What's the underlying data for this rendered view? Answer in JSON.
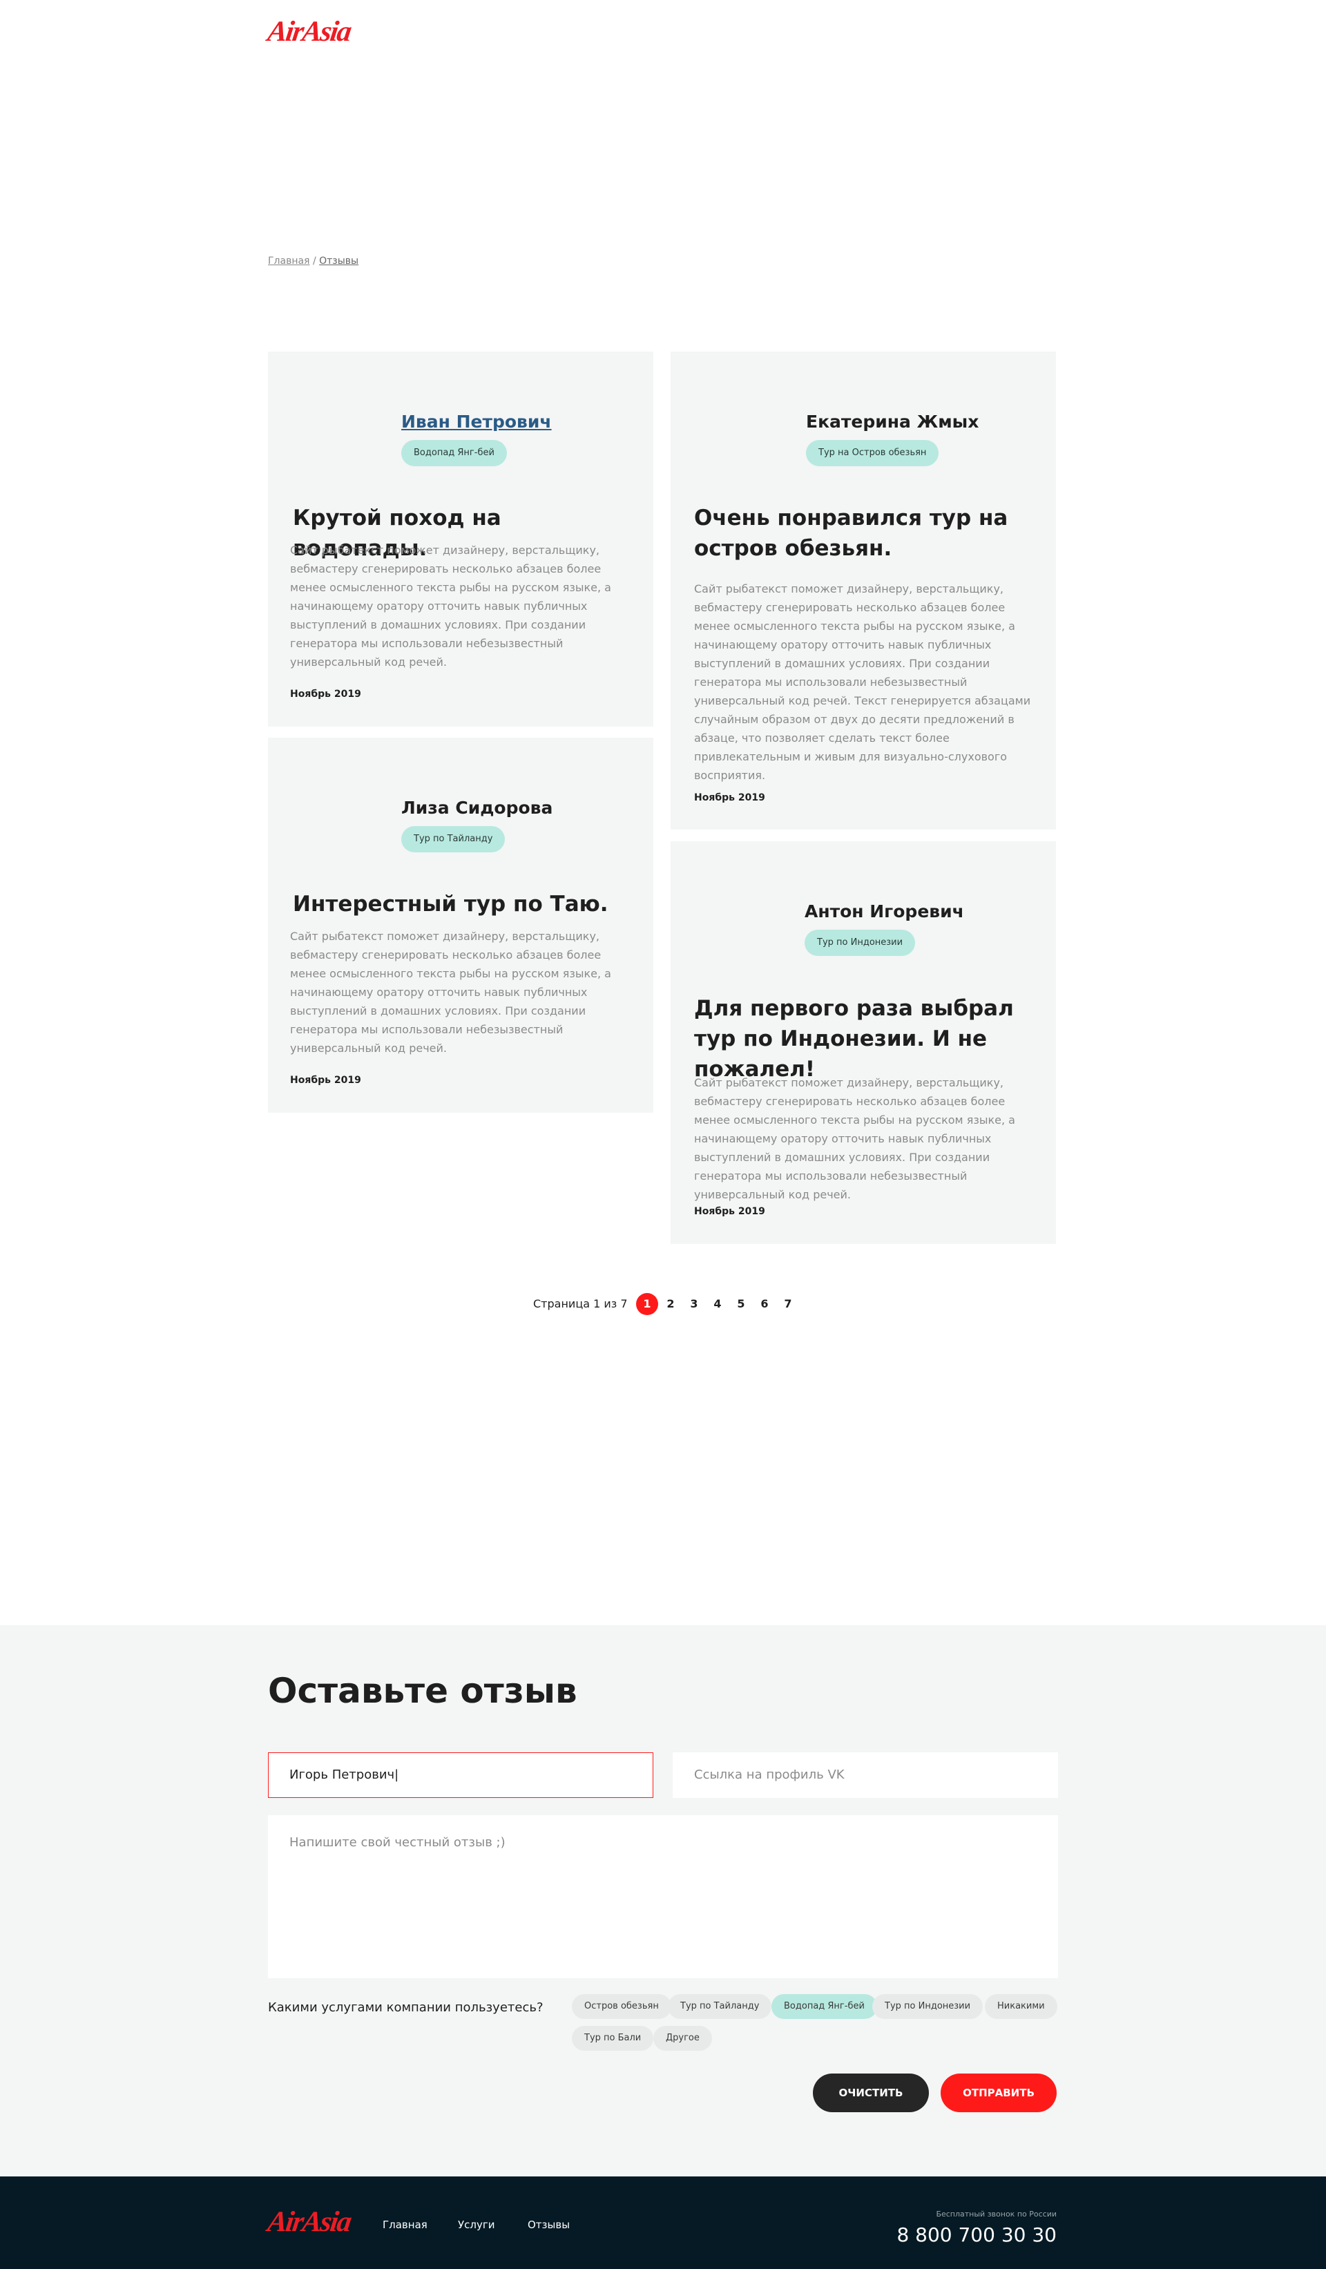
{
  "brand": {
    "logo_text": "AirAsia",
    "accent": "#ed1c24"
  },
  "breadcrumb": {
    "home": "Главная",
    "separator": "/",
    "current": "Отзывы"
  },
  "reviews": [
    {
      "author": "Иван Петрович",
      "tour": "Водопад Янг-бей",
      "title": "Крутой поход на водопады.",
      "text": "Сайт рыбатекст поможет дизайнеру, верстальщику, вебмастеру сгенерировать несколько абзацев более менее осмысленного текста рыбы на русском языке, а начинающему оратору отточить навык публичных выступлений в домашних условиях. При создании генератора мы использовали небезызвестный универсальный код речей.",
      "date": "Ноябрь 2019"
    },
    {
      "author": "Екатерина Жмых",
      "tour": "Тур на Остров обезьян",
      "title": "Очень понравился тур на остров обезьян.",
      "text": "Сайт рыбатекст поможет дизайнеру, верстальщику, вебмастеру сгенерировать несколько абзацев более менее осмысленного текста рыбы на русском языке, а начинающему оратору отточить навык публичных выступлений в домашних условиях. При создании генератора мы использовали небезызвестный универсальный код речей. Текст генерируется абзацами случайным образом от двух до десяти предложений в абзаце, что позволяет сделать текст более привлекательным и живым для визуально-слухового восприятия.",
      "date": "Ноябрь 2019"
    },
    {
      "author": "Лиза Сидорова",
      "tour": "Тур по Тайланду",
      "title": "Интерестный тур по Таю.",
      "text": "Сайт рыбатекст поможет дизайнеру, верстальщику, вебмастеру сгенерировать несколько абзацев более менее осмысленного текста рыбы на русском языке, а начинающему оратору отточить навык публичных выступлений в домашних условиях. При создании генератора мы использовали небезызвестный универсальный код речей.",
      "date": "Ноябрь 2019"
    },
    {
      "author": "Антон Игоревич",
      "tour": "Тур по Индонезии",
      "title": "Для первого раза выбрал тур по Индонезии. И не пожалел!",
      "text": "Сайт рыбатекст поможет дизайнеру, верстальщику, вебмастеру сгенерировать несколько абзацев более менее осмысленного текста рыбы на русском языке, а начинающему оратору отточить навык публичных выступлений в домашних условиях. При создании генератора мы использовали небезызвестный универсальный код речей.",
      "date": "Ноябрь 2019"
    }
  ],
  "pagination": {
    "label": "Страница 1 из 7",
    "pages": [
      "1",
      "2",
      "3",
      "4",
      "5",
      "6",
      "7"
    ],
    "current": "1"
  },
  "form": {
    "title": "Оставьте отзыв",
    "name_value": "Игорь Петрович|",
    "vk_placeholder": "Ссылка на профиль VK",
    "review_placeholder": "Напишите свой честный отзыв ;)",
    "services_label": "Какими услугами компании пользуетесь?",
    "services": [
      "Остров обезьян",
      "Тур по Тайланду",
      "Водопад Янг-бей",
      "Тур по Индонезии",
      "Никакими",
      "Тур по Бали",
      "Другое"
    ],
    "selected_service": "Водопад Янг-бей",
    "clear_label": "ОЧИСТИТЬ",
    "submit_label": "ОТПРАВИТЬ"
  },
  "footer": {
    "links": [
      "Главная",
      "Услуги",
      "Отзывы"
    ],
    "phone_caption": "Бесплатный звонок по России",
    "phone": "8 800 700 30 30"
  }
}
